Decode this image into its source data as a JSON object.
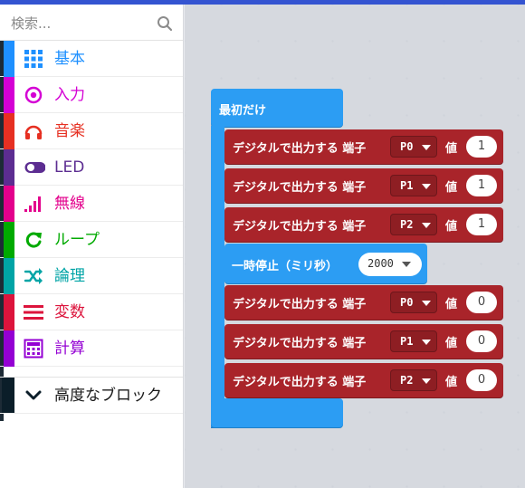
{
  "search": {
    "placeholder": "検索..."
  },
  "categories": [
    {
      "label": "基本",
      "icon": "grid-icon",
      "color": "#1e90ff"
    },
    {
      "label": "入力",
      "icon": "target-icon",
      "color": "#d400d4"
    },
    {
      "label": "音楽",
      "icon": "headphones-icon",
      "color": "#e63022"
    },
    {
      "label": "LED",
      "icon": "toggle-icon",
      "color": "#5c2d91"
    },
    {
      "label": "無線",
      "icon": "signal-bars-icon",
      "color": "#e3008c"
    },
    {
      "label": "ループ",
      "icon": "loop-arrow-icon",
      "color": "#00aa00"
    },
    {
      "label": "論理",
      "icon": "shuffle-icon",
      "color": "#00a4a6"
    },
    {
      "label": "変数",
      "icon": "list-lines-icon",
      "color": "#dc143c"
    },
    {
      "label": "計算",
      "icon": "calculator-icon",
      "color": "#9400d3"
    }
  ],
  "advanced": {
    "label": "高度なブロック",
    "icon": "chevron-down-icon",
    "color": "#0b1e29"
  },
  "workspace": {
    "hat_label": "最初だけ",
    "write_label": "デジタルで出力する 端子",
    "value_label": "値",
    "blocks_before": [
      {
        "pin": "P0",
        "value": "1"
      },
      {
        "pin": "P1",
        "value": "1"
      },
      {
        "pin": "P2",
        "value": "1"
      }
    ],
    "pause": {
      "label": "一時停止（ミリ秒）",
      "value": "2000"
    },
    "blocks_after": [
      {
        "pin": "P0",
        "value": "0"
      },
      {
        "pin": "P1",
        "value": "0"
      },
      {
        "pin": "P2",
        "value": "0"
      }
    ],
    "colors": {
      "basic": "#2c9df3",
      "pins": "#a9242a"
    }
  }
}
